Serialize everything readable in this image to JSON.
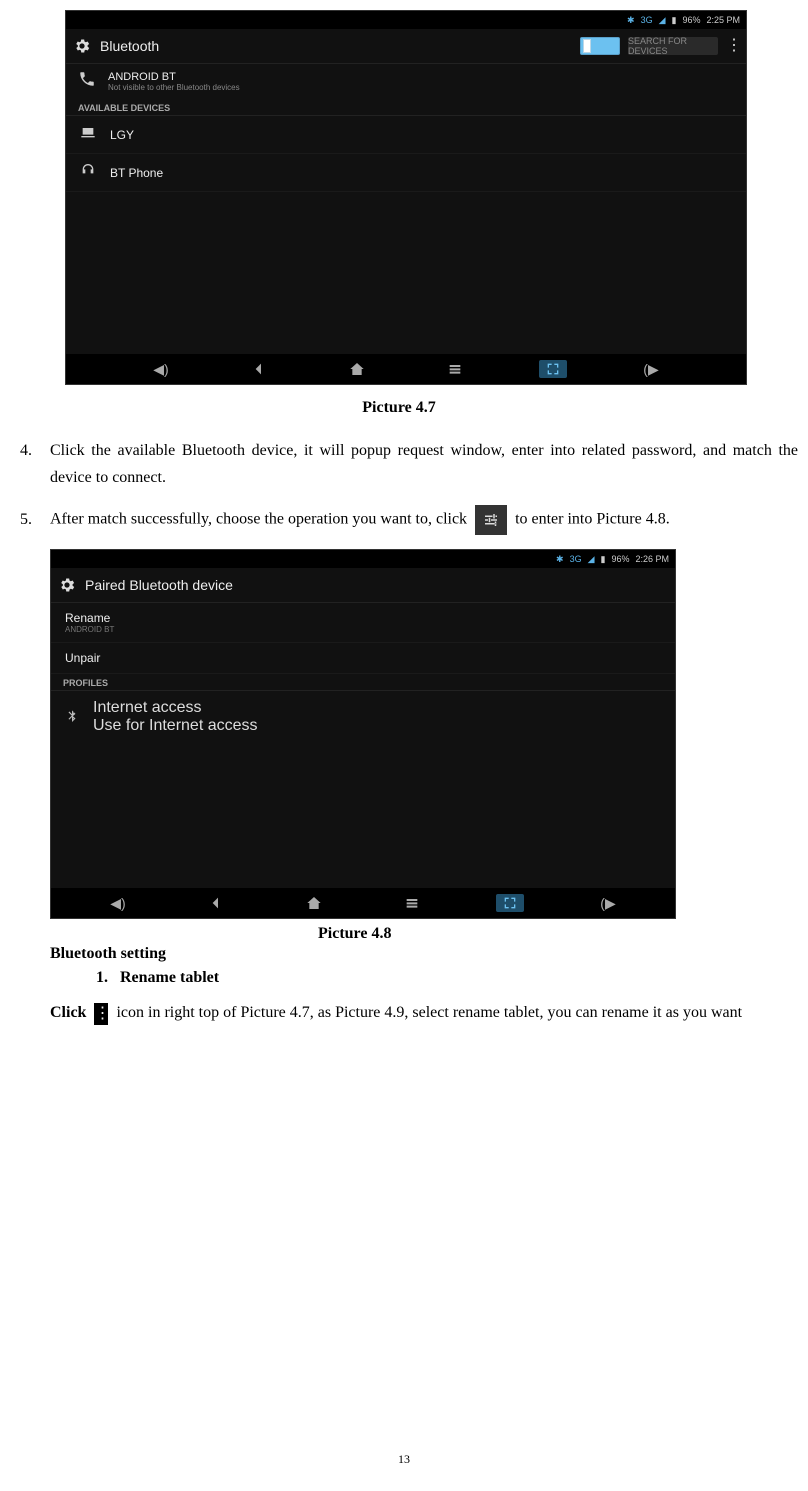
{
  "page_number": "13",
  "figure47": {
    "caption": "Picture 4.7",
    "status": {
      "sig3g": "3G",
      "battery": "96%",
      "time": "2:25 PM"
    },
    "title": "Bluetooth",
    "search_label": "SEARCH FOR DEVICES",
    "my_device": {
      "name": "ANDROID BT",
      "subtitle": "Not visible to other Bluetooth devices"
    },
    "section_label": "AVAILABLE DEVICES",
    "devices": [
      {
        "name": "LGY"
      },
      {
        "name": "BT Phone"
      }
    ]
  },
  "steps": {
    "s4": "Click the available Bluetooth device, it will popup request window, enter into related password, and match the device to connect.",
    "s5_a": "After match successfully, choose the operation you want to, click ",
    "s5_b": " to enter into Picture 4.8."
  },
  "figure48": {
    "caption": "Picture 4.8",
    "status": {
      "sig3g": "3G",
      "battery": "96%",
      "time": "2:26 PM"
    },
    "title": "Paired Bluetooth device",
    "rename": {
      "label": "Rename",
      "sub": "ANDROID BT"
    },
    "unpair": {
      "label": "Unpair"
    },
    "section_label": "PROFILES",
    "profile": {
      "title": "Internet access",
      "sub": "Use for Internet access"
    }
  },
  "btsetting": {
    "heading": "Bluetooth setting",
    "sub_num": "1.",
    "sub_label": "Rename tablet",
    "click_bold": "Click ",
    "para_rest": " icon in right top of Picture 4.7, as Picture 4.9, select rename tablet, you can rename it as you want"
  }
}
